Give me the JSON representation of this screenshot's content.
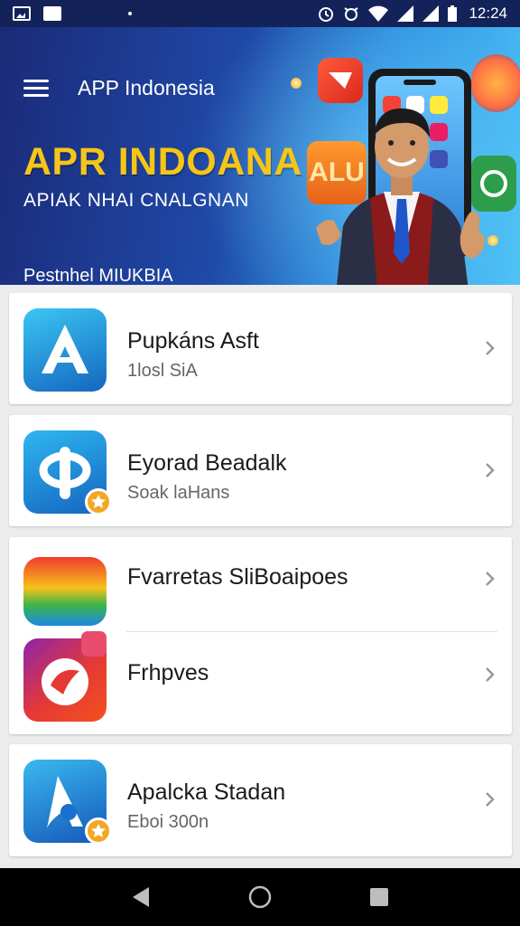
{
  "status_bar": {
    "time": "12:24",
    "icons": [
      "image-icon",
      "message-icon",
      "alarm-icon",
      "vibrate-icon",
      "wifi-icon",
      "signal-icon",
      "signal-icon",
      "battery-icon"
    ]
  },
  "header": {
    "app_title": "APP Indonesia",
    "menu_icon": "hamburger-menu-icon"
  },
  "banner": {
    "headline": "APR INDOANA",
    "subhead": "APIAK NHAI CNALGNAN",
    "tagline": "Pestnhel MIUKBIA",
    "badge_text": "ALU"
  },
  "list": {
    "items": [
      {
        "title": "Pupkáns Asft",
        "subtitle": "1losl SiA",
        "icon": "a-logo-icon",
        "badge": false
      },
      {
        "title": "Eyorad Beadalk",
        "subtitle": "Soak laHans",
        "icon": "phi-logo-icon",
        "badge": true
      },
      {
        "title": "Fvarretas SliBoaipoes",
        "subtitle": "",
        "icon": "rainbow-wave-icon",
        "badge": false
      },
      {
        "title": "Frhpves",
        "subtitle": "",
        "icon": "red-swirl-icon",
        "badge": false
      },
      {
        "title": "Apalcka Stadan",
        "subtitle": "Eboi 300n",
        "icon": "a-drop-icon",
        "badge": true
      }
    ]
  },
  "nav_bar": {
    "buttons": [
      "back-icon",
      "home-icon",
      "recents-icon"
    ]
  },
  "colors": {
    "banner_dark": "#1b2a78",
    "banner_light": "#4fc3f7",
    "headline": "#f5c518",
    "badge_orange": "#f5a623"
  }
}
